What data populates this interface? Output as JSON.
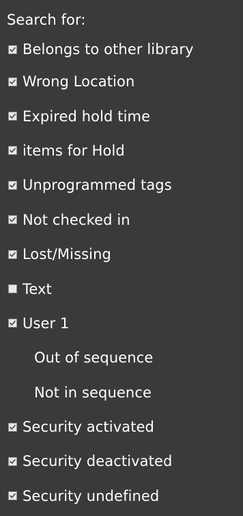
{
  "panel": {
    "heading": "Search for:",
    "options": [
      {
        "label": "Belongs to other library",
        "checked": true,
        "has_checkbox": true
      },
      {
        "label": "Wrong Location",
        "checked": true,
        "has_checkbox": true
      },
      {
        "label": "Expired hold time",
        "checked": true,
        "has_checkbox": true
      },
      {
        "label": "items for Hold",
        "checked": true,
        "has_checkbox": true
      },
      {
        "label": "Unprogrammed tags",
        "checked": true,
        "has_checkbox": true
      },
      {
        "label": "Not checked in",
        "checked": true,
        "has_checkbox": true
      },
      {
        "label": "Lost/Missing",
        "checked": true,
        "has_checkbox": true
      },
      {
        "label": "Text",
        "checked": false,
        "has_checkbox": true
      },
      {
        "label": "User 1",
        "checked": true,
        "has_checkbox": true
      },
      {
        "label": "Out of sequence",
        "checked": false,
        "has_checkbox": false
      },
      {
        "label": "Not in sequence",
        "checked": false,
        "has_checkbox": false
      },
      {
        "label": "Security activated",
        "checked": true,
        "has_checkbox": true
      },
      {
        "label": "Security deactivated",
        "checked": true,
        "has_checkbox": true
      },
      {
        "label": "Security undefined",
        "checked": true,
        "has_checkbox": true
      }
    ]
  },
  "colors": {
    "background": "#3a3a3a",
    "text": "#ffffff",
    "checkbox_fill": "#e9e9e9",
    "checkbox_border": "#8c8c8c",
    "checkmark": "#555555"
  }
}
